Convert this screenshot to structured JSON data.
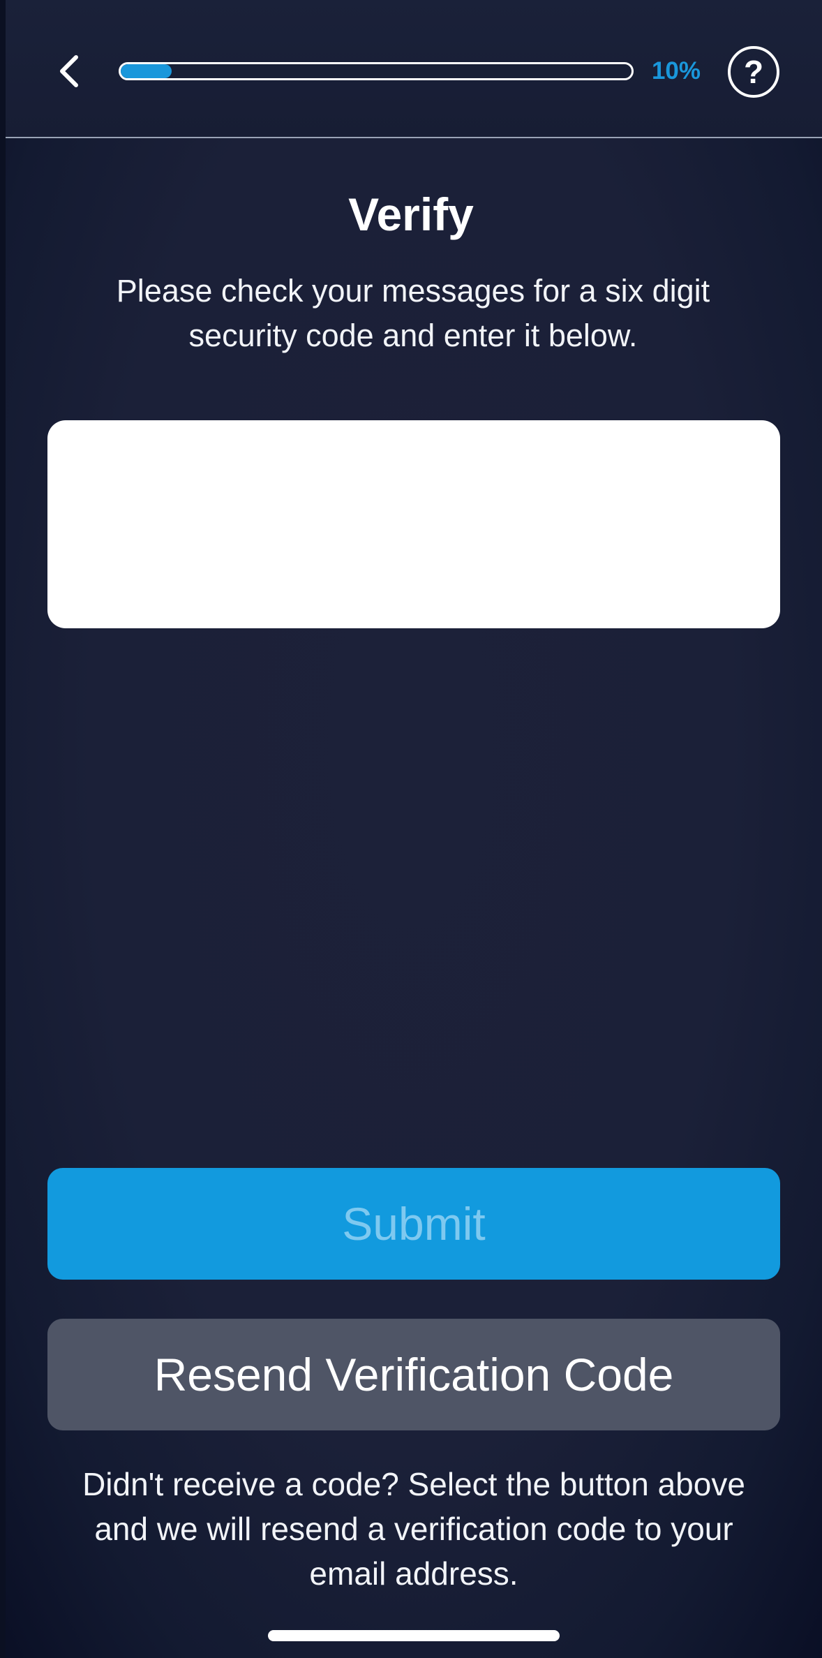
{
  "header": {
    "back_icon": "chevron-left-icon",
    "progress_percent": 10,
    "progress_label": "10%",
    "help_icon": "question-mark-icon",
    "help_glyph": "?",
    "accent_color": "#1a97db"
  },
  "main": {
    "title": "Verify",
    "instructions": "Please check your messages for a six digit security code and enter it below.",
    "code_input": {
      "value": "",
      "placeholder": ""
    },
    "submit_label": "Submit",
    "submit_color": "#129ade",
    "resend_label": "Resend Verification Code",
    "resend_color": "#4f5566",
    "footnote": "Didn't receive a code? Select the button above and we will resend a verification code to your email address."
  }
}
